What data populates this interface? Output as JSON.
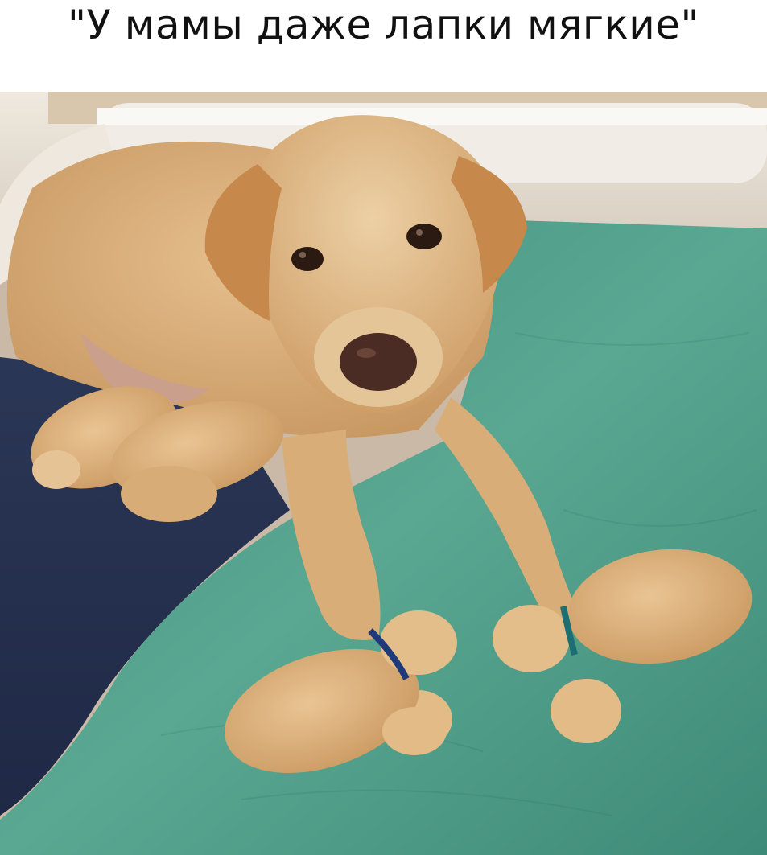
{
  "caption": {
    "text": "\"У мамы даже лапки мягкие\""
  },
  "photo": {
    "subject": "labrador-with-puppies",
    "colors": {
      "wall": "#e9e2d6",
      "blanket_teal": "#4f9a86",
      "blanket_navy": "#2c3a5c",
      "fur": "#d6a872",
      "collar_blue": "#1f3a7a",
      "collar_teal": "#1c6e73"
    }
  }
}
